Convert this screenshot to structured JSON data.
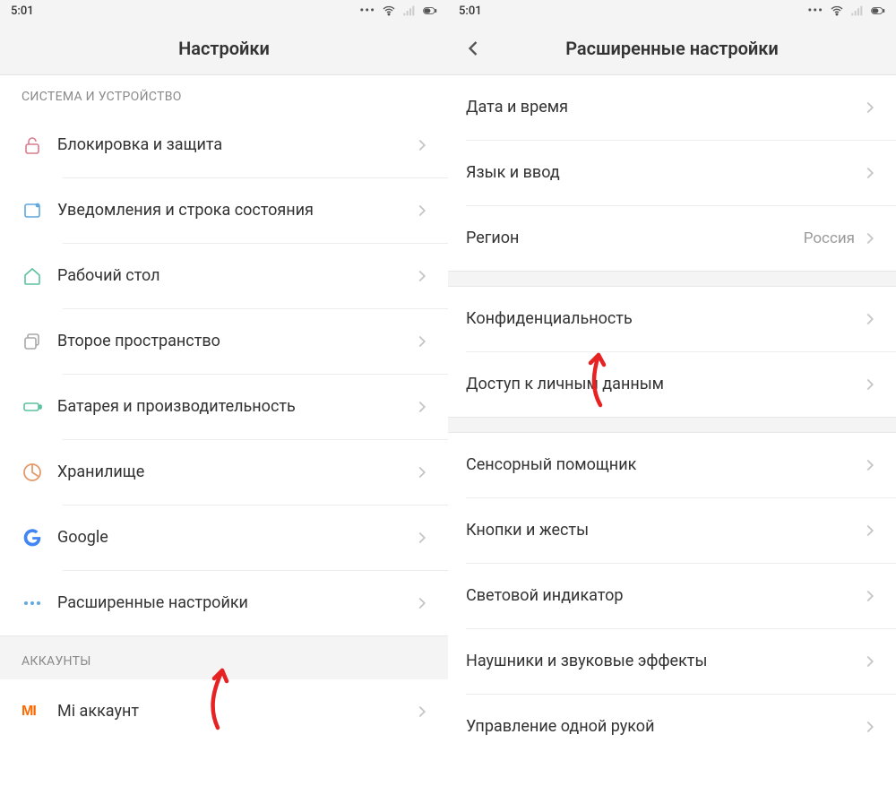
{
  "status": {
    "time": "5:01"
  },
  "left": {
    "title": "Настройки",
    "section1": "СИСТЕМА И УСТРОЙСТВО",
    "section2": "АККАУНТЫ",
    "items": {
      "lock": "Блокировка и защита",
      "notif": "Уведомления и строка состояния",
      "home": "Рабочий стол",
      "second": "Второе пространство",
      "battery": "Батарея и производительность",
      "storage": "Хранилище",
      "google": "Google",
      "advanced": "Расширенные настройки",
      "mi": "Mi аккаунт"
    }
  },
  "right": {
    "title": "Расширенные настройки",
    "items": {
      "datetime": "Дата и время",
      "lang": "Язык и ввод",
      "region": "Регион",
      "region_value": "Россия",
      "privacy": "Конфиденциальность",
      "personal": "Доступ к личным данным",
      "assist": "Сенсорный помощник",
      "buttons": "Кнопки и жесты",
      "led": "Световой индикатор",
      "headphones": "Наушники и звуковые эффекты",
      "onehand": "Управление одной рукой"
    }
  }
}
